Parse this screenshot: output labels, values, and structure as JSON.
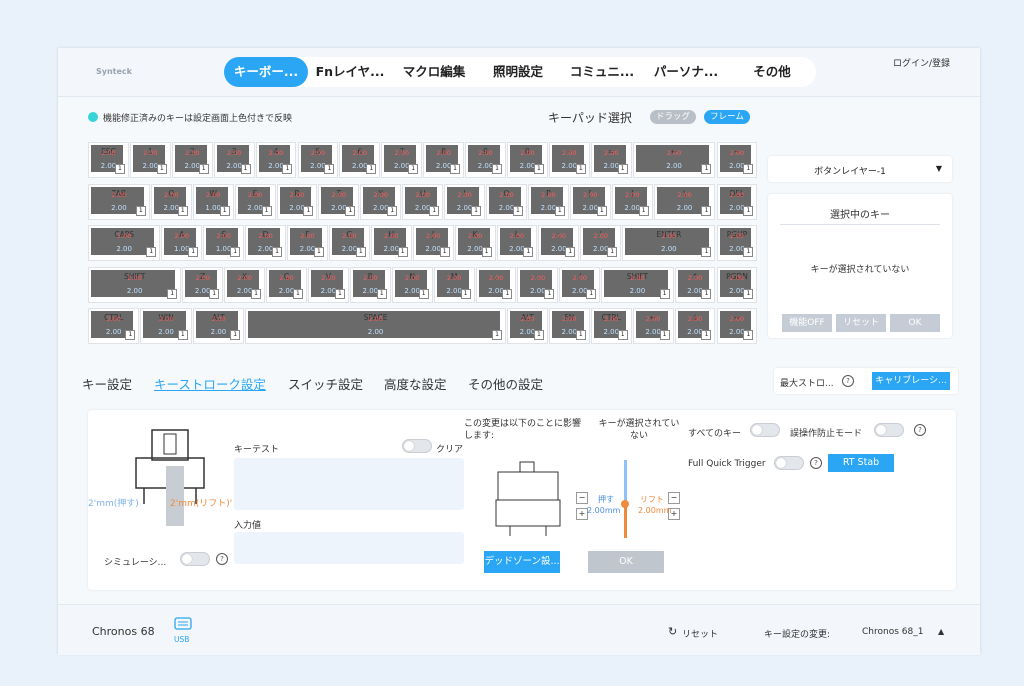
{
  "header": {
    "logo": "Synteck",
    "tabs": [
      {
        "label": "キーボー..."
      },
      {
        "label": "Fnレイヤ..."
      },
      {
        "label": "マクロ編集"
      },
      {
        "label": "照明設定"
      },
      {
        "label": "コミュニ..."
      },
      {
        "label": "パーソナ..."
      },
      {
        "label": "その他"
      }
    ],
    "login": "ログイン/登録"
  },
  "toolbar": {
    "legend_text": "機能修正済みのキーは設定画面上色付きで反映",
    "keypad_label": "キーパッド選択",
    "drag_label": "ドラッグ",
    "frame_label": "フレーム"
  },
  "colors": {
    "accent": "#2aa6f4",
    "legend_dot": "#36d4d9",
    "key_cap": "#6a6a6a"
  },
  "keyboard": {
    "rows": [
      [
        {
          "l": "ESC",
          "v": "2.00"
        },
        {
          "l": "1",
          "v": "2.00"
        },
        {
          "l": "2",
          "v": "2.00"
        },
        {
          "l": "3",
          "v": "2.00"
        },
        {
          "l": "4",
          "v": "2.00"
        },
        {
          "l": "5",
          "v": "2.00"
        },
        {
          "l": "6",
          "v": "2.00"
        },
        {
          "l": "7",
          "v": "2.00"
        },
        {
          "l": "8",
          "v": "2.00"
        },
        {
          "l": "9",
          "v": "2.00"
        },
        {
          "l": "0",
          "v": "2.00"
        },
        {
          "l": "-",
          "v": "2.00"
        },
        {
          "l": "=",
          "v": "2.00"
        },
        {
          "l": "←",
          "v": "2.00"
        },
        {
          "l": "~",
          "v": "2.00"
        }
      ],
      [
        {
          "l": "TAB",
          "v": "2.00"
        },
        {
          "l": "Q",
          "v": "2.00"
        },
        {
          "l": "W",
          "v": "1.00"
        },
        {
          "l": "E",
          "v": "2.00"
        },
        {
          "l": "R",
          "v": "2.00"
        },
        {
          "l": "T",
          "v": "2.00"
        },
        {
          "l": "Y",
          "v": "2.00"
        },
        {
          "l": "U",
          "v": "2.00"
        },
        {
          "l": "I",
          "v": "2.00"
        },
        {
          "l": "O",
          "v": "2.00"
        },
        {
          "l": "P",
          "v": "2.00"
        },
        {
          "l": "[",
          "v": "2.00"
        },
        {
          "l": "]",
          "v": "2.00"
        },
        {
          "l": "\\",
          "v": "2.00"
        },
        {
          "l": "DEL",
          "v": "2.00"
        }
      ],
      [
        {
          "l": "CAPS",
          "v": "2.00"
        },
        {
          "l": "A",
          "v": "1.00"
        },
        {
          "l": "S",
          "v": "1.00"
        },
        {
          "l": "D",
          "v": "2.00"
        },
        {
          "l": "F",
          "v": "2.00"
        },
        {
          "l": "G",
          "v": "2.00"
        },
        {
          "l": "H",
          "v": "2.00"
        },
        {
          "l": "J",
          "v": "2.00"
        },
        {
          "l": "K",
          "v": "2.00"
        },
        {
          "l": "L",
          "v": "2.00"
        },
        {
          "l": ";",
          "v": "2.00"
        },
        {
          "l": "'",
          "v": "2.00"
        },
        {
          "l": "ENTER",
          "v": "2.00"
        },
        {
          "l": "PGUP",
          "v": "2.00"
        }
      ],
      [
        {
          "l": "SHIFT",
          "v": "2.00"
        },
        {
          "l": "Z",
          "v": "2.00"
        },
        {
          "l": "X",
          "v": "2.00"
        },
        {
          "l": "C",
          "v": "2.00"
        },
        {
          "l": "V",
          "v": "2.00"
        },
        {
          "l": "B",
          "v": "2.00"
        },
        {
          "l": "N",
          "v": "2.00"
        },
        {
          "l": "M",
          "v": "2.00"
        },
        {
          "l": ",",
          "v": "2.00"
        },
        {
          "l": ".",
          "v": "2.00"
        },
        {
          "l": "/",
          "v": "2.00"
        },
        {
          "l": "SHIFT",
          "v": "2.00"
        },
        {
          "l": "↑",
          "v": "2.00"
        },
        {
          "l": "PGDN",
          "v": "2.00"
        }
      ],
      [
        {
          "l": "CTRL",
          "v": "2.00"
        },
        {
          "l": "WIN",
          "v": "2.00"
        },
        {
          "l": "ALT",
          "v": "2.00"
        },
        {
          "l": "SPACE",
          "v": "2.00"
        },
        {
          "l": "ALT",
          "v": "2.00"
        },
        {
          "l": "FN",
          "v": "2.00"
        },
        {
          "l": "CTRL",
          "v": "2.00"
        },
        {
          "l": "←",
          "v": "2.00"
        },
        {
          "l": "↓",
          "v": "2.00"
        },
        {
          "l": "→",
          "v": "2.00"
        }
      ]
    ],
    "key_index": "1",
    "red_value": "2.00"
  },
  "right_panel": {
    "layer": "ボタンレイヤー-1",
    "selected_title": "選択中のキー",
    "no_selection": "キーが選択されていない",
    "off_btn": "機能OFF",
    "reset_btn": "リセット",
    "ok_btn": "OK"
  },
  "subtabs": [
    {
      "label": "キー設定"
    },
    {
      "label": "キーストローク設定"
    },
    {
      "label": "スイッチ設定"
    },
    {
      "label": "高度な設定"
    },
    {
      "label": "その他の設定"
    }
  ],
  "max_stroke": {
    "label": "最大ストロ...",
    "calibration": "キャリブレーシ..."
  },
  "stroke": {
    "press_label": "2'mm(押す)",
    "lift_label": "2'mm(リフト)'",
    "simulation": "シミュレーシ...",
    "key_test": "キーテスト",
    "clear": "クリア",
    "input_value": "入力値",
    "impact_note": "この変更は以下のことに影響します:",
    "deadzone_btn": "デッドゾーン設...",
    "no_key": "キーが選択されていない",
    "push": "押す",
    "push_value": "2.00mm",
    "lift": "リフト",
    "lift_value": "2.00mm",
    "ok_btn": "OK",
    "all_keys": "すべてのキー",
    "anti_misop": "誤操作防止モード",
    "full_qt": "Full Quick Trigger",
    "rt_stab": "RT Stab"
  },
  "footer": {
    "device": "Chronos 68",
    "usb": "USB",
    "reset": "リセット",
    "change_label": "キー設定の変更:",
    "profile": "Chronos 68_1"
  }
}
